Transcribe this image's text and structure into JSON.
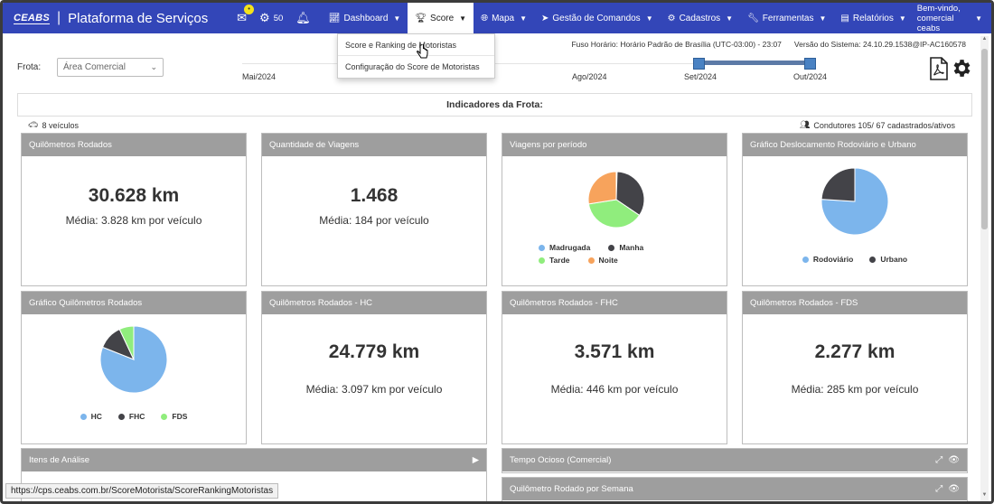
{
  "navbar": {
    "logo": "CEABS",
    "title": "Plataforma de Serviços",
    "mail_badge": "•",
    "settings_count": "50",
    "menus": [
      {
        "label": "Dashboard",
        "icon": "chart-icon"
      },
      {
        "label": "Score",
        "icon": "trophy-icon",
        "active": true
      },
      {
        "label": "Mapa",
        "icon": "globe-icon"
      },
      {
        "label": "Gestão de Comandos",
        "icon": "send-icon"
      },
      {
        "label": "Cadastros",
        "icon": "gear-icon"
      },
      {
        "label": "Ferramentas",
        "icon": "wrench-icon"
      },
      {
        "label": "Relatórios",
        "icon": "report-icon"
      }
    ],
    "user_line1": "Bem-vindo,",
    "user_line2": "comercial ceabs"
  },
  "dropdown": {
    "items": [
      "Score e Ranking de Motoristas",
      "Configuração do Score de Motoristas"
    ]
  },
  "info": {
    "timezone": "Fuso Horário: Horário Padrão de Brasília (UTC-03:00) - 23:07",
    "version": "Versão do Sistema: 24.10.29.1538@IP-AC160578"
  },
  "filter": {
    "label": "Frota:",
    "value": "Área Comercial"
  },
  "timeline": {
    "labels": [
      "Mai/2024",
      "Ago/2024",
      "Set/2024",
      "Out/2024"
    ],
    "selected_start": "Set/2024",
    "selected_end": "Out/2024"
  },
  "indicators": {
    "title": "Indicadores da Frota:",
    "vehicles": "8 veículos",
    "drivers": "Condutores 105/ 67 cadastrados/ativos"
  },
  "cards": {
    "km": {
      "title": "Quilômetros Rodados",
      "value": "30.628 km",
      "avg": "Média: 3.828 km por veículo"
    },
    "trips": {
      "title": "Quantidade de Viagens",
      "value": "1.468",
      "avg": "Média: 184 por veículo"
    },
    "trips_period": {
      "title": "Viagens por período"
    },
    "displacement": {
      "title": "Gráfico Deslocamento Rodoviário e Urbano"
    },
    "km_chart": {
      "title": "Gráfico Quilômetros Rodados"
    },
    "km_hc": {
      "title": "Quilômetros Rodados - HC",
      "value": "24.779 km",
      "avg": "Média: 3.097 km por veículo"
    },
    "km_fhc": {
      "title": "Quilômetros Rodados - FHC",
      "value": "3.571 km",
      "avg": "Média: 446 km por veículo"
    },
    "km_fds": {
      "title": "Quilômetros Rodados - FDS",
      "value": "2.277 km",
      "avg": "Média: 285 km por veículo"
    },
    "analysis": {
      "title": "Itens de Análise"
    },
    "idle": {
      "title": "Tempo Ocioso (Comercial)"
    },
    "weekly": {
      "title": "Quilômetro Rodado por Semana"
    }
  },
  "chart_data": [
    {
      "type": "pie",
      "categories": [
        "Madrugada",
        "Manha",
        "Tarde",
        "Noite"
      ],
      "values": [
        0.5,
        34,
        38,
        27.5
      ],
      "colors": [
        "#7cb5ec",
        "#434348",
        "#90ed7d",
        "#f7a35c"
      ]
    },
    {
      "type": "pie",
      "categories": [
        "Rodoviário",
        "Urbano"
      ],
      "values": [
        76,
        24
      ],
      "colors": [
        "#7cb5ec",
        "#434348"
      ]
    },
    {
      "type": "pie",
      "categories": [
        "HC",
        "FHC",
        "FDS"
      ],
      "values": [
        81,
        12,
        7
      ],
      "colors": [
        "#7cb5ec",
        "#434348",
        "#90ed7d"
      ]
    }
  ],
  "status_url": "https://cps.ceabs.com.br/ScoreMotorista/ScoreRankingMotoristas"
}
